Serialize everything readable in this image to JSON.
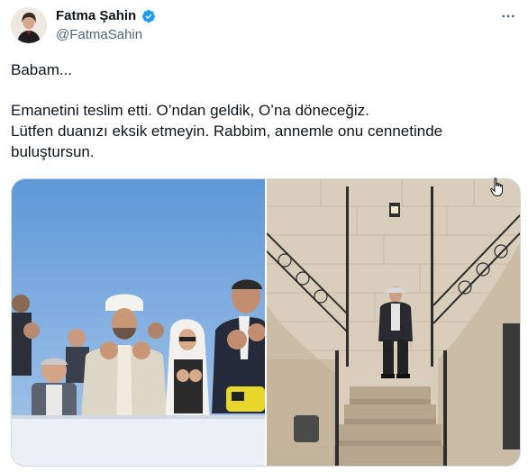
{
  "author": {
    "name": "Fatma Şahin",
    "handle": "@FatmaSahin",
    "verified": true,
    "avatar_icon": "profile-photo"
  },
  "header": {
    "more_icon": "more-horizontal-icon"
  },
  "tweet": {
    "lines": [
      "Babam...",
      "Emanetini teslim etti. O’ndan geldik, O’na döneceğiz.",
      "Lütfen duanızı eksik etmeyin. Rabbim, annemle onu cennetinde",
      "buluştursun."
    ]
  },
  "media": {
    "photos": [
      {
        "icon": "funeral-prayer-photo"
      },
      {
        "icon": "man-on-stairs-photo"
      }
    ]
  },
  "colors": {
    "text": "#0f1419",
    "secondary": "#536471",
    "verified": "#1d9bf0",
    "border": "#cfd9de"
  },
  "cursor_icon": "hand-pointer-cursor"
}
